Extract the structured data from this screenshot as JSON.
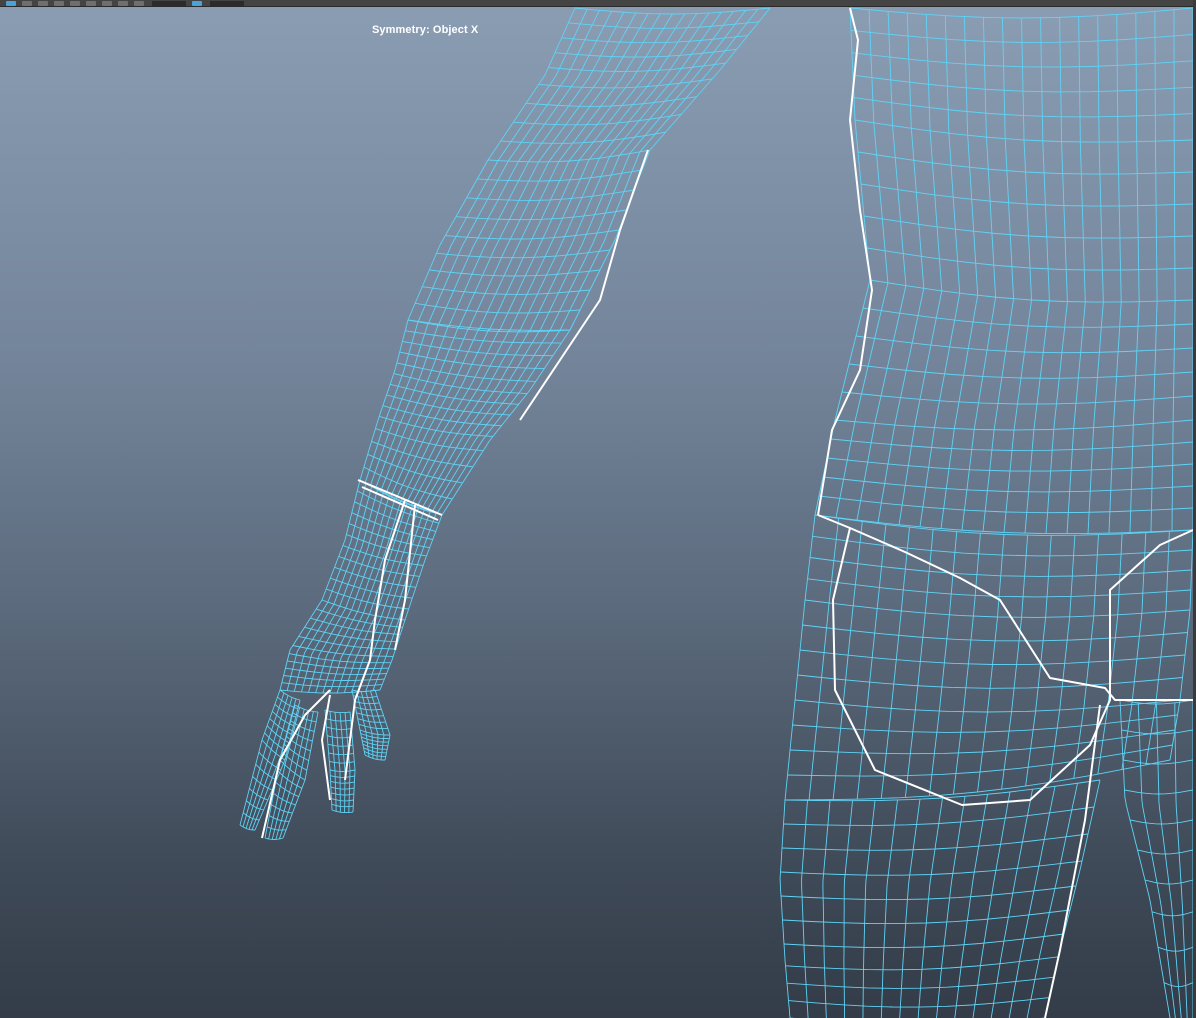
{
  "viewport": {
    "hud": {
      "symmetry_label": "Symmetry: Object X"
    },
    "colors": {
      "background_top": "#8a9db3",
      "background_bottom": "#333c48",
      "wireframe": "#5fd3f5",
      "selected_edges": "#ffffff",
      "hud_text": "#ffffff"
    },
    "icons": [
      "select-tool-icon",
      "lasso-tool-icon",
      "paint-select-icon",
      "move-tool-icon",
      "rotate-tool-icon",
      "scale-tool-icon",
      "snap-grid-icon",
      "snap-curve-icon",
      "snap-point-icon",
      "symmetry-icon"
    ]
  }
}
